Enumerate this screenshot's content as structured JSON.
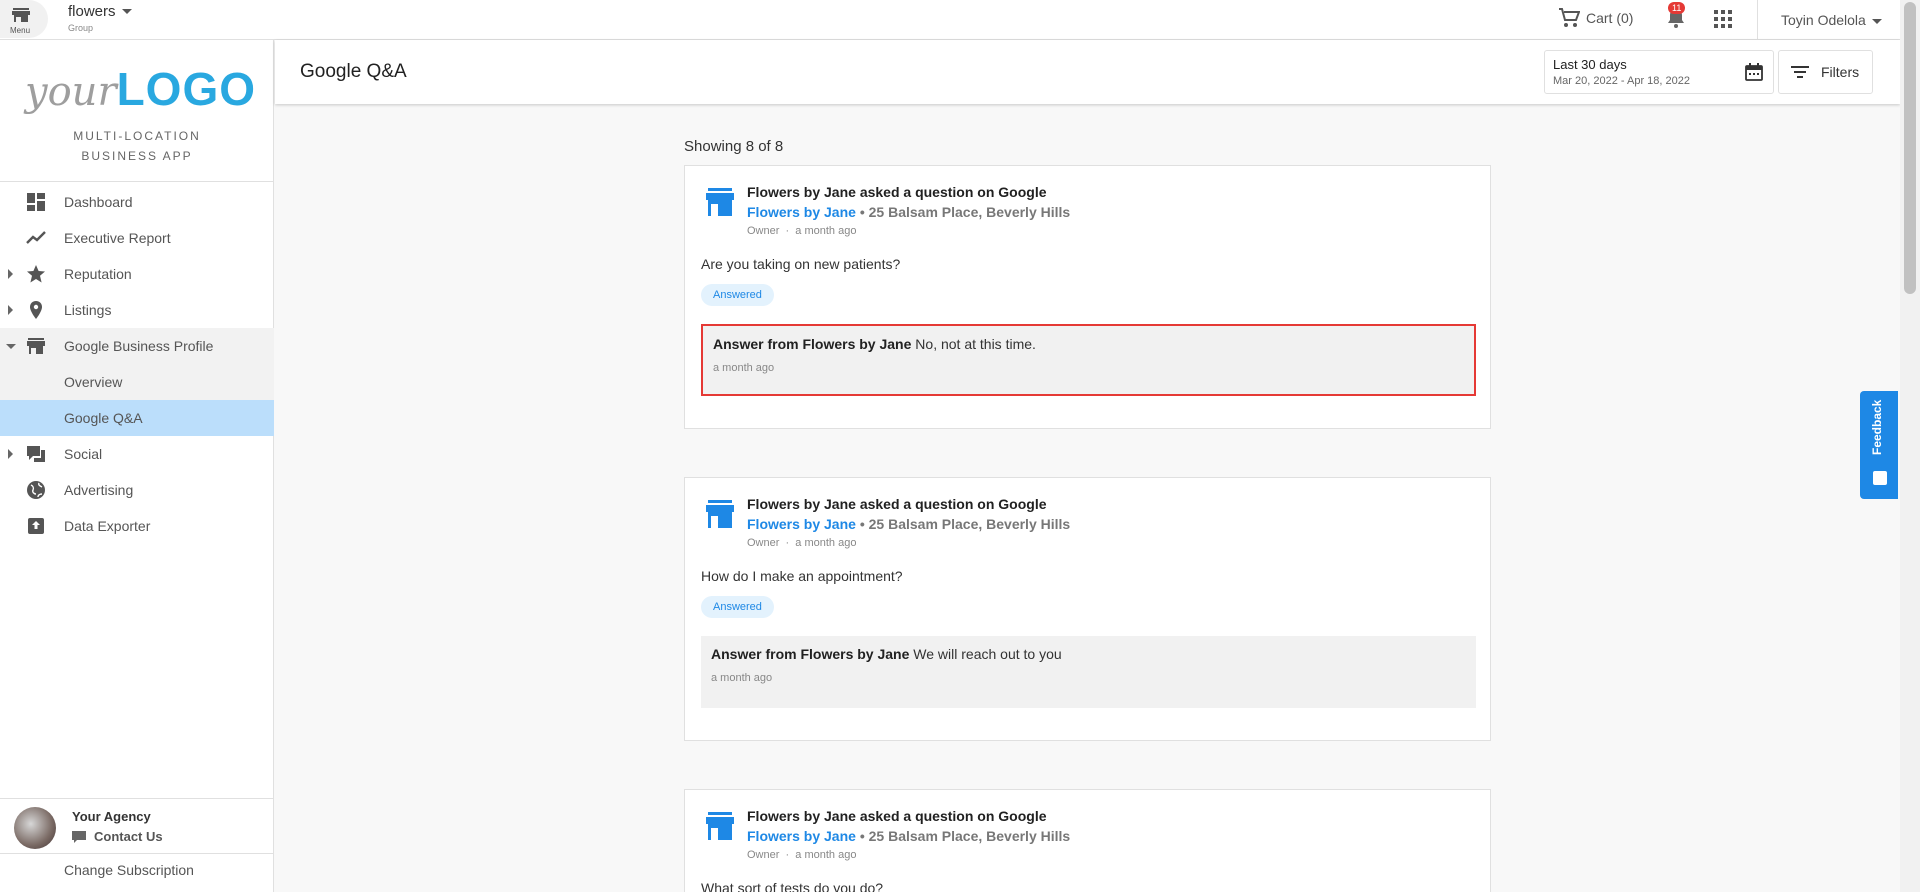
{
  "topbar": {
    "menu_label": "Menu",
    "group_name": "flowers",
    "group_sub": "Group",
    "cart_label": "Cart (0)",
    "notification_count": "11",
    "user_name": "Toyin Odelola"
  },
  "sidebar": {
    "logo_your": "your",
    "logo_logo": "LOGO",
    "tagline_1": "MULTI-LOCATION",
    "tagline_2": "BUSINESS APP",
    "items": [
      {
        "label": "Dashboard",
        "icon": "dashboard-icon"
      },
      {
        "label": "Executive Report",
        "icon": "trending-icon"
      },
      {
        "label": "Reputation",
        "icon": "star-icon"
      },
      {
        "label": "Listings",
        "icon": "location-pin-icon"
      },
      {
        "label": "Google Business Profile",
        "icon": "store-icon"
      },
      {
        "label": "Overview"
      },
      {
        "label": "Google Q&A"
      },
      {
        "label": "Social",
        "icon": "chat-icon"
      },
      {
        "label": "Advertising",
        "icon": "globe-icon"
      },
      {
        "label": "Data Exporter",
        "icon": "export-icon"
      }
    ],
    "agency_name": "Your Agency",
    "contact_label": "Contact Us",
    "subscription_label": "Change Subscription"
  },
  "header": {
    "title": "Google Q&A",
    "date_range_label": "Last 30 days",
    "date_range_value": "Mar 20, 2022 - Apr 18, 2022",
    "filters_label": "Filters"
  },
  "content": {
    "showing": "Showing 8 of 8",
    "cards": [
      {
        "title": "Flowers by Jane asked a question on Google",
        "business": "Flowers by Jane",
        "address": " • 25 Balsam Place, Beverly Hills",
        "role": "Owner",
        "time": "a month ago",
        "question": "Are you taking on new patients?",
        "status": "Answered",
        "answer_prefix": "Answer from Flowers by Jane",
        "answer_text": " No, not at this time.",
        "answer_time": "a month ago"
      },
      {
        "title": "Flowers by Jane asked a question on Google",
        "business": "Flowers by Jane",
        "address": " • 25 Balsam Place, Beverly Hills",
        "role": "Owner",
        "time": "a month ago",
        "question": "How do I make an appointment?",
        "status": "Answered",
        "answer_prefix": "Answer from Flowers by Jane",
        "answer_text": " We will reach out to you",
        "answer_time": "a month ago"
      },
      {
        "title": "Flowers by Jane asked a question on Google",
        "business": "Flowers by Jane",
        "address": " • 25 Balsam Place, Beverly Hills",
        "role": "Owner",
        "time": "a month ago",
        "question": "What sort of tests do you do?"
      }
    ]
  },
  "feedback_label": "Feedback",
  "colors": {
    "accent": "#1e88e5",
    "active_nav": "#bbdefb",
    "highlight_border": "#e53935",
    "logo_blue": "#29a8e0"
  }
}
